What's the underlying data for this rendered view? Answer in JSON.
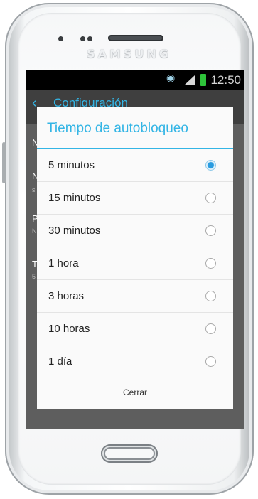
{
  "device": {
    "brand": "SAMSUNG"
  },
  "status_bar": {
    "time": "12:50"
  },
  "action_bar": {
    "title": "Configuración"
  },
  "background_items": [
    {
      "title": "N",
      "subtitle": ""
    },
    {
      "title": "N",
      "subtitle": "s"
    },
    {
      "title": "P",
      "subtitle": "N"
    },
    {
      "title": "T",
      "subtitle": "5"
    }
  ],
  "dialog": {
    "title": "Tiempo de autobloqueo",
    "options": [
      {
        "label": "5 minutos",
        "selected": true
      },
      {
        "label": "15 minutos",
        "selected": false
      },
      {
        "label": "30 minutos",
        "selected": false
      },
      {
        "label": "1 hora",
        "selected": false
      },
      {
        "label": "3 horas",
        "selected": false
      },
      {
        "label": "10 horas",
        "selected": false
      },
      {
        "label": "1 día",
        "selected": false
      }
    ],
    "close_label": "Cerrar"
  },
  "colors": {
    "accent": "#33b5e5",
    "battery": "#2ec43a"
  }
}
